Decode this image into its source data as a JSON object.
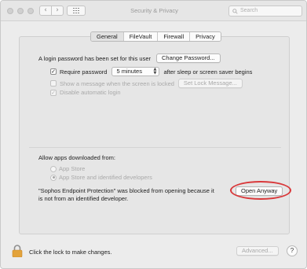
{
  "window": {
    "title": "Security & Privacy",
    "nav_back": "‹",
    "nav_forward": "›"
  },
  "search": {
    "placeholder": "Search"
  },
  "tabs": [
    {
      "label": "General",
      "selected": true
    },
    {
      "label": "FileVault",
      "selected": false
    },
    {
      "label": "Firewall",
      "selected": false
    },
    {
      "label": "Privacy",
      "selected": false
    }
  ],
  "general": {
    "login_password_text": "A login password has been set for this user",
    "change_password_label": "Change Password...",
    "require_password_label": "Require password",
    "require_password_checked": true,
    "require_password_delay": "5 minutes",
    "after_sleep_text": "after sleep or screen saver begins",
    "show_message_label": "Show a message when the screen is locked",
    "show_message_checked": false,
    "set_lock_message_label": "Set Lock Message...",
    "disable_auto_login_label": "Disable automatic login",
    "disable_auto_login_checked": true
  },
  "allow_apps": {
    "heading": "Allow apps downloaded from:",
    "options": [
      {
        "label": "App Store",
        "selected": false
      },
      {
        "label": "App Store and identified developers",
        "selected": true
      }
    ],
    "blocked_message_line1": "\"Sophos Endpoint Protection\" was blocked from opening because it",
    "blocked_message_line2": "is not from an identified developer.",
    "open_anyway_label": "Open Anyway"
  },
  "bottom": {
    "lock_text": "Click the lock to make changes.",
    "advanced_label": "Advanced...",
    "help_label": "?"
  },
  "colors": {
    "highlight_ring": "#d9383a",
    "lock_icon": "#e3a33b"
  }
}
